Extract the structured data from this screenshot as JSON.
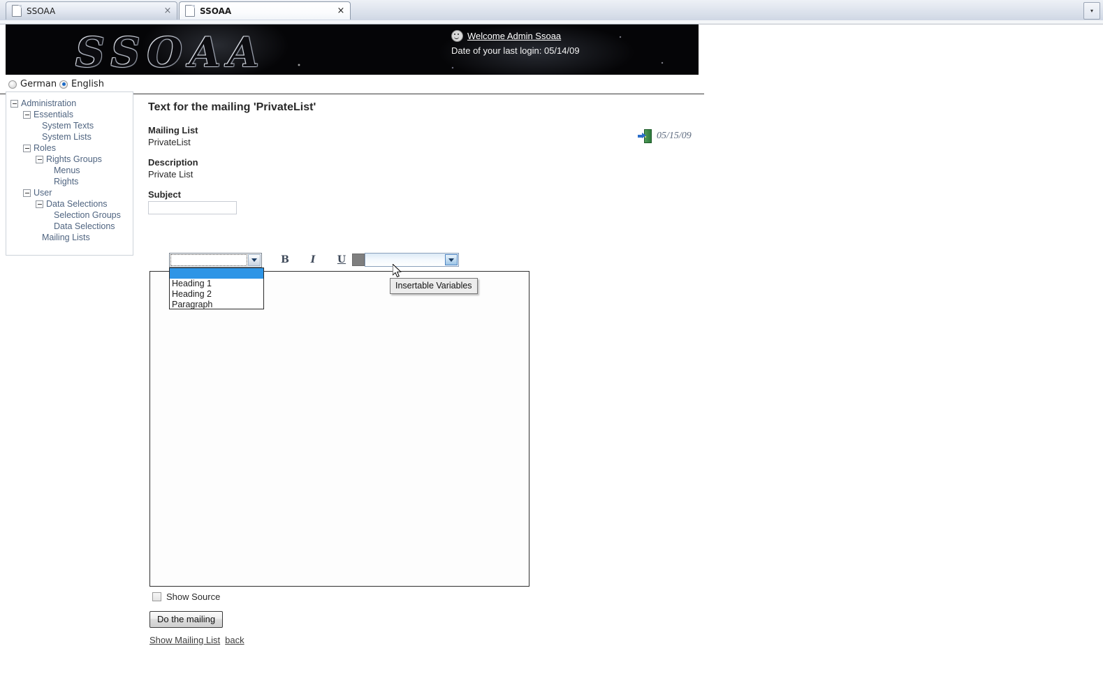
{
  "browser": {
    "tabs": [
      {
        "title": "SSOAA",
        "active": false,
        "close_label": "×"
      },
      {
        "title": "SSOAA",
        "active": true,
        "close_label": "×"
      }
    ],
    "tab_list_button": "▾"
  },
  "banner": {
    "logo_text": "SSOAA",
    "welcome_link": "Welcome Admin Ssoaa",
    "last_login": "Date of your last login: 05/14/09"
  },
  "language_bar": {
    "german_label": "German",
    "english_label": "English",
    "selected": "English"
  },
  "logout": {
    "date": "05/15/09"
  },
  "sidebar": {
    "items": [
      {
        "label": "Administration",
        "level": 0,
        "expandable": true
      },
      {
        "label": "Essentials",
        "level": 1,
        "expandable": true
      },
      {
        "label": "System Texts",
        "level": 3,
        "expandable": false
      },
      {
        "label": "System Lists",
        "level": 3,
        "expandable": false
      },
      {
        "label": "Roles",
        "level": 1,
        "expandable": true
      },
      {
        "label": "Rights Groups",
        "level": 2,
        "expandable": true
      },
      {
        "label": "Menus",
        "level": 4,
        "expandable": false
      },
      {
        "label": "Rights",
        "level": 4,
        "expandable": false
      },
      {
        "label": "User",
        "level": 1,
        "expandable": true
      },
      {
        "label": "Data Selections",
        "level": 2,
        "expandable": true
      },
      {
        "label": "Selection Groups",
        "level": 4,
        "expandable": false
      },
      {
        "label": "Data Selections",
        "level": 4,
        "expandable": false
      },
      {
        "label": "Mailing Lists",
        "level": 3,
        "expandable": false
      }
    ]
  },
  "main": {
    "title": "Text for the mailing 'PrivateList'",
    "mailing_list_label": "Mailing List",
    "mailing_list_value": "PrivateList",
    "description_label": "Description",
    "description_value": "Private List",
    "subject_label": "Subject",
    "subject_value": ""
  },
  "editor": {
    "format_select": {
      "value": "",
      "open": true,
      "options": [
        "",
        "Heading 1",
        "Heading 2",
        "Paragraph"
      ]
    },
    "bold_label": "B",
    "italic_label": "I",
    "underline_label": "U",
    "text_color": "#7f7f7f",
    "variables_select": {
      "value": "",
      "tooltip": "Insertable Variables"
    },
    "body_html": ""
  },
  "footer": {
    "show_source_label": "Show Source",
    "show_source_checked": false,
    "do_mailing_label": "Do the mailing",
    "show_mailing_list_link": "Show Mailing List",
    "back_link": "back"
  },
  "colors": {
    "highlight": "#2e95e6",
    "tree_link": "#4f6480",
    "banner_bg": "#050507"
  }
}
